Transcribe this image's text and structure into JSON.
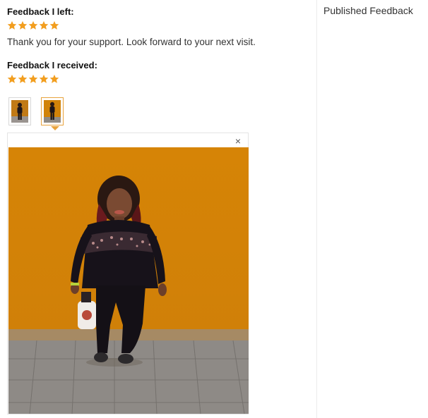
{
  "feedback_left": {
    "heading": "Feedback I left:",
    "rating": 5,
    "comment": "Thank you for your support. Look forward to your next visit."
  },
  "feedback_received": {
    "heading": "Feedback I received:",
    "rating": 5
  },
  "sidebar": {
    "title": "Published Feedback"
  },
  "viewer": {
    "close_glyph": "×"
  },
  "colors": {
    "star": "#f29e1f",
    "wall": "#d68406",
    "active_border": "#e8a33d"
  }
}
